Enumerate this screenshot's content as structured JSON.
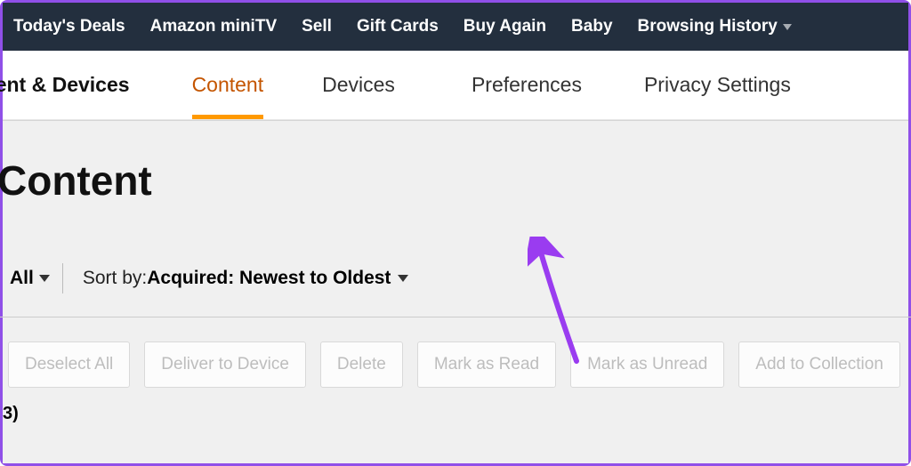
{
  "topnav": {
    "items": [
      {
        "label": "Today's Deals"
      },
      {
        "label": "Amazon miniTV"
      },
      {
        "label": "Sell"
      },
      {
        "label": "Gift Cards"
      },
      {
        "label": "Buy Again"
      },
      {
        "label": "Baby"
      },
      {
        "label": "Browsing History",
        "dropdown": true
      }
    ]
  },
  "subnav": {
    "title": "ntent & Devices",
    "tabs": [
      {
        "label": "Content",
        "active": true
      },
      {
        "label": "Devices"
      },
      {
        "label": "Preferences"
      },
      {
        "label": "Privacy Settings"
      }
    ]
  },
  "page": {
    "heading": "Content"
  },
  "filters": {
    "all_label": "All",
    "sort_prefix": "Sort by: ",
    "sort_value": "Acquired: Newest to Oldest"
  },
  "actions": [
    "Deselect All",
    "Deliver to Device",
    "Delete",
    "Mark as Read",
    "Mark as Unread",
    "Add to Collection"
  ],
  "count_fragment": "3)",
  "annotation": {
    "color": "#9a3cf0"
  }
}
